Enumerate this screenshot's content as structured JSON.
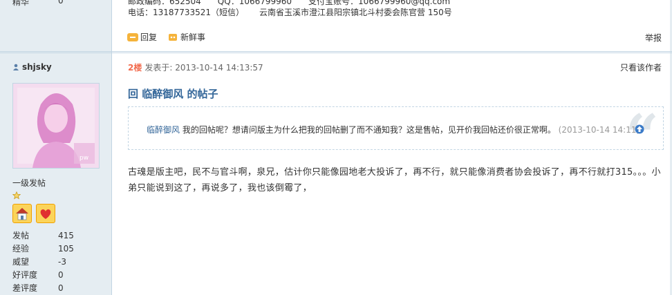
{
  "prev_post": {
    "left_label": "精华",
    "left_value": "0",
    "cut_line": "邮政编码：652504　　QQ：1066799960　　支付宝账号：1066799960@qq.com",
    "phone_label": "电话：",
    "phone": "13187733521（短信）",
    "address": "云南省玉溪市澄江县阳宗镇北斗村委会陈官营 150号",
    "reply_label": "回复",
    "fresh_label": "新鲜事",
    "report_label": "举报"
  },
  "author": {
    "name": "shjsky",
    "avatar_watermark": "pw",
    "rank": "一级发帖",
    "stats": [
      {
        "label": "发帖",
        "value": "415"
      },
      {
        "label": "经验",
        "value": "105"
      },
      {
        "label": "威望",
        "value": "-3"
      },
      {
        "label": "好评度",
        "value": "0"
      },
      {
        "label": "差评度",
        "value": "0"
      }
    ]
  },
  "post": {
    "floor": "2楼",
    "posted_label": "发表于:",
    "date": "2013-10-14 14:13:57",
    "only_author": "只看该作者",
    "title": "回 临醉御风 的帖子",
    "quote": {
      "author": "临醉御风",
      "text": " 我的回帖呢？想请问版主为什么把我的回帖删了而不通知我？这是售帖，见开价我回帖还价很正常啊。",
      "date": "(2013-10-14 14:11)"
    },
    "body": "古魂是版主吧，民不与官斗啊，泉兄，估计你只能像园地老大投诉了，再不行，就只能像消费者协会投诉了，再不行就打315。。。小弟只能说到这了，再说多了，我也该倒霉了，"
  },
  "colors": {
    "sidebar_bg": "#e5edf2",
    "border": "#c2d5e3",
    "link": "#336699",
    "floor": "#f26c4f"
  }
}
